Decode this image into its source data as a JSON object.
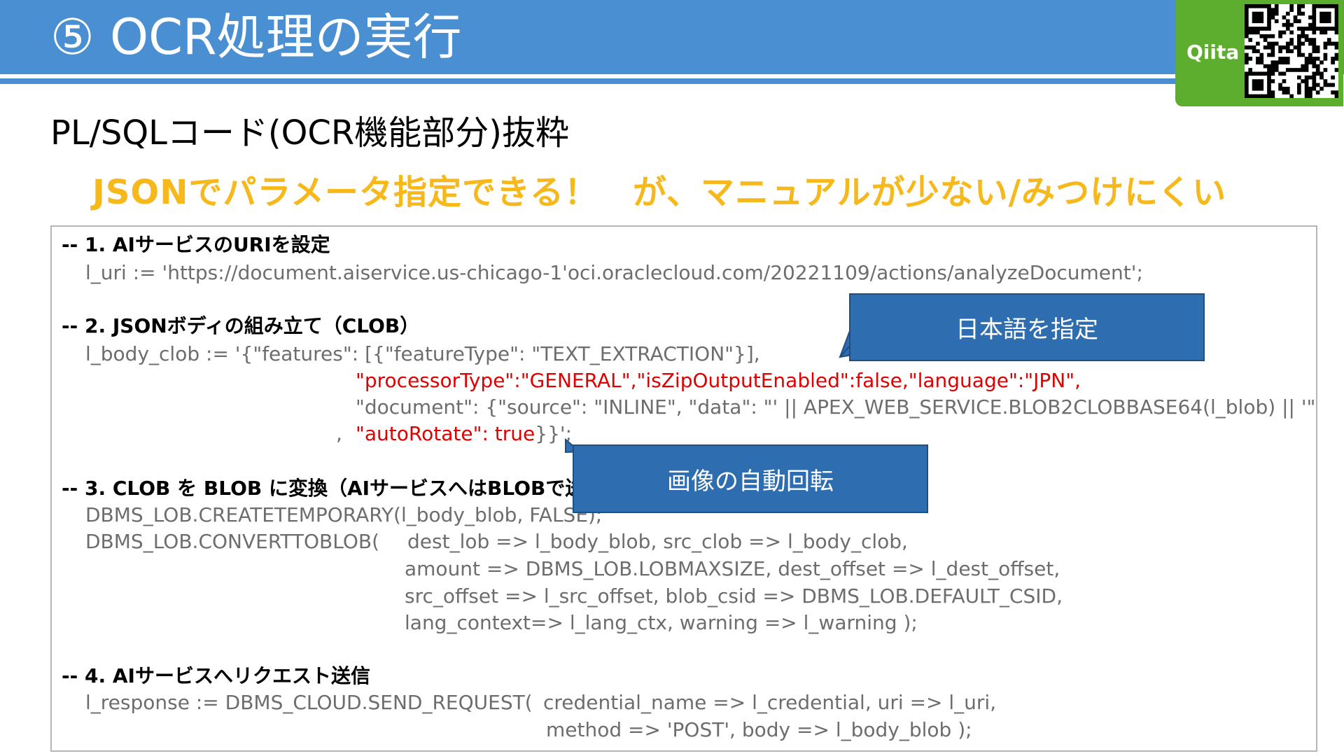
{
  "header": {
    "title": "⑤ OCR処理の実行"
  },
  "badge": {
    "label": "Qiita",
    "qr_icon": "qr-code-icon"
  },
  "subtitle": "PL/SQLコード(OCR機能部分)抜粋",
  "note": "JSONでパラメータ指定できる！　が、マニュアルが少ない/みつけにくい",
  "code": {
    "s1_comment": "-- 1. AIサービスのURIを設定",
    "s1_l1": "l_uri := 'https://document.aiservice.us-chicago-1'oci.oraclecloud.com/20221109/actions/analyzeDocument';",
    "s2_comment": "-- 2. JSONボディの組み立て（CLOB）",
    "s2_l1": "l_body_clob := '{\"features\": [{\"featureType\": \"TEXT_EXTRACTION\"}],",
    "s2_l2": "\"processorType\":\"GENERAL\",\"isZipOutputEnabled\":false,\"language\":\"JPN\",",
    "s2_l3": "\"document\": {\"source\": \"INLINE\", \"data\": \"'  || APEX_WEB_SERVICE.BLOB2CLOBBASE64(l_blob) || '\"",
    "s2_l4_comma": ",",
    "s2_l4_red": "\"autoRotate\": true",
    "s2_l4_end": "}}';",
    "s3_comment": "-- 3. CLOB を BLOB に変換（AIサービスへはBLOBで送",
    "s3_l1": "DBMS_LOB.CREATETEMPORARY(l_body_blob, FALSE);",
    "s3_l2a": "DBMS_LOB.CONVERTTOBLOB(",
    "s3_l2b": "dest_lob     => l_body_blob,   src_clob     => l_body_clob,",
    "s3_l3": "amount       =>   DBMS_LOB.LOBMAXSIZE,            dest_offset => l_dest_offset,",
    "s3_l4": "src_offset   => l_src_offset,    blob_csid    => DBMS_LOB.DEFAULT_CSID,",
    "s3_l5": "lang_context=> l_lang_ctx,      warning      => l_warning    );",
    "s4_comment": "-- 4. AIサービスへリクエスト送信",
    "s4_l1a": "l_response := DBMS_CLOUD.SEND_REQUEST(",
    "s4_l1b": "credential_name => l_credential,       uri              => l_uri,",
    "s4_l2": "method           => 'POST',                   body             => l_body_blob     );"
  },
  "callouts": {
    "language": "日本語を指定",
    "rotate": "画像の自動回転"
  },
  "colors": {
    "header": "#4a8fd2",
    "note": "#f6b81b",
    "callout": "#2e6eb0",
    "qiita": "#5dad2e",
    "highlight": "#e00000"
  }
}
